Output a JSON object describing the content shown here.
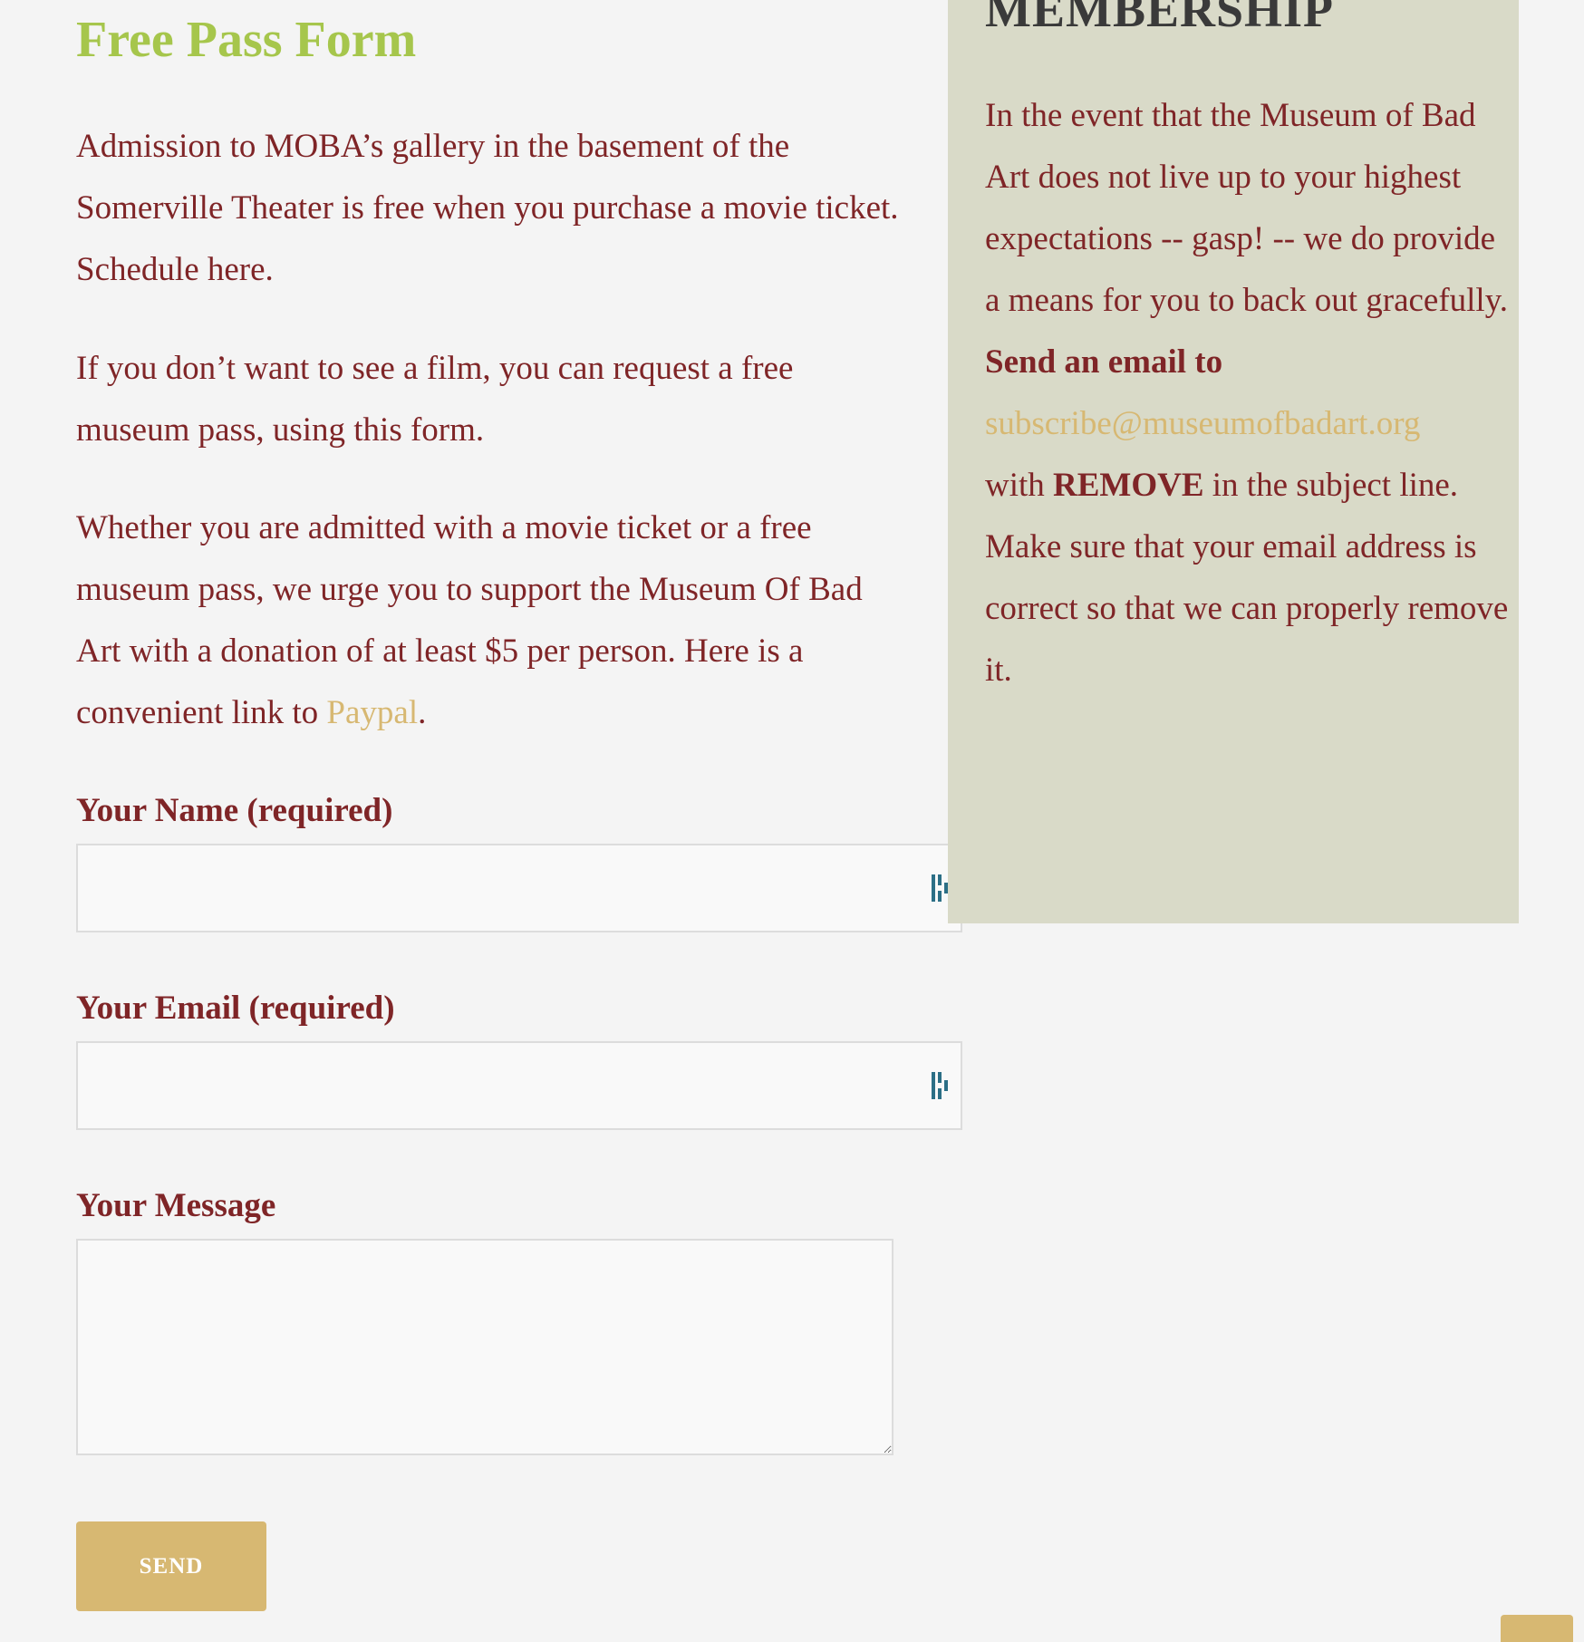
{
  "page": {
    "title": "Free Pass Form"
  },
  "intro": {
    "p1": "Admission to MOBA’s gallery in the basement of the Somerville Theater is free when you purchase a movie ticket. Schedule here.",
    "p2": "If you don’t want to see a film, you can request a free museum pass, using this form.",
    "p3_text": "Whether you are admitted with a movie ticket or a free museum pass, we urge you to support the Museum Of Bad Art with a donation of at least $5 per person. Here is a convenient link to ",
    "p3_link": "Paypal",
    "p3_end": "."
  },
  "form": {
    "name_label": "Your Name (required)",
    "name_value": "",
    "email_label": "Your Email (required)",
    "email_value": "",
    "message_label": "Your Message",
    "message_value": "",
    "send_label": "SEND"
  },
  "sidebar": {
    "heading": "MEMBERSHIP",
    "text1": "In the event that the Museum of Bad Art does not live up to your highest expectations -- gasp! -- we do provide a means for you to back out gracefully.",
    "send_prefix": "Send an email to",
    "email": "subscribe@museumofbadart.org",
    "with_word": "with",
    "remove_word": "REMOVE",
    "text2": "in the subject line. Make sure that your email address is correct so that we can properly remove it."
  },
  "colors": {
    "title_green": "#a6c64c",
    "body_maroon": "#7f2527",
    "link_gold": "#d7b872",
    "sidebar_bg": "#d9dac8",
    "page_bg": "#f4f4f4",
    "heading_dark": "#3a3a3a",
    "input_icon": "#2c6f86"
  },
  "icons": {
    "input_keys": "password-manager-key-icon",
    "resize": "resize-handle-icon",
    "scroll_top": "scroll-to-top-icon"
  }
}
